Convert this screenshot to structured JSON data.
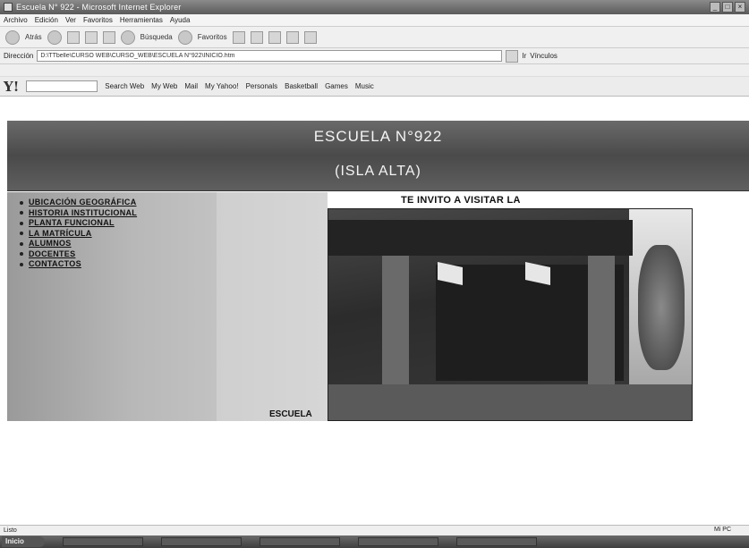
{
  "window": {
    "title": "Escuela N° 922 - Microsoft Internet Explorer"
  },
  "menu": [
    "Archivo",
    "Edición",
    "Ver",
    "Favoritos",
    "Herramientas",
    "Ayuda"
  ],
  "toolbar": {
    "back": "Atrás",
    "search": "Búsqueda",
    "favorites": "Favoritos",
    "links": "Vínculos"
  },
  "address": {
    "label": "Dirección",
    "url": "D:\\TTbelle\\CURSO WEB\\CURSO_WEB\\ESCUELA N°922\\INICIO.htm",
    "go": "Ir"
  },
  "yahoo": {
    "logo": "Y!",
    "search": "Search Web",
    "items": [
      "My Web",
      "Mail",
      "My Yahoo!",
      "Personals",
      "Basketball",
      "Games",
      "Music"
    ]
  },
  "page": {
    "school_name": "ESCUELA N°922",
    "school_place": "(ISLA ALTA)",
    "invite": "TE INVITO A VISITAR LA",
    "photo_caption": "ESCUELA",
    "nav": [
      "UBICACIÓN GEOGRÁFICA",
      "HISTORIA INSTITUCIONAL",
      "PLANTA FUNCIONAL",
      "LA MATRÍCULA",
      "ALUMNOS",
      "DOCENTES",
      "CONTACTOS"
    ]
  },
  "status": {
    "left": "Listo",
    "right": "Mi PC"
  },
  "taskbar": {
    "start": "Inicio"
  }
}
